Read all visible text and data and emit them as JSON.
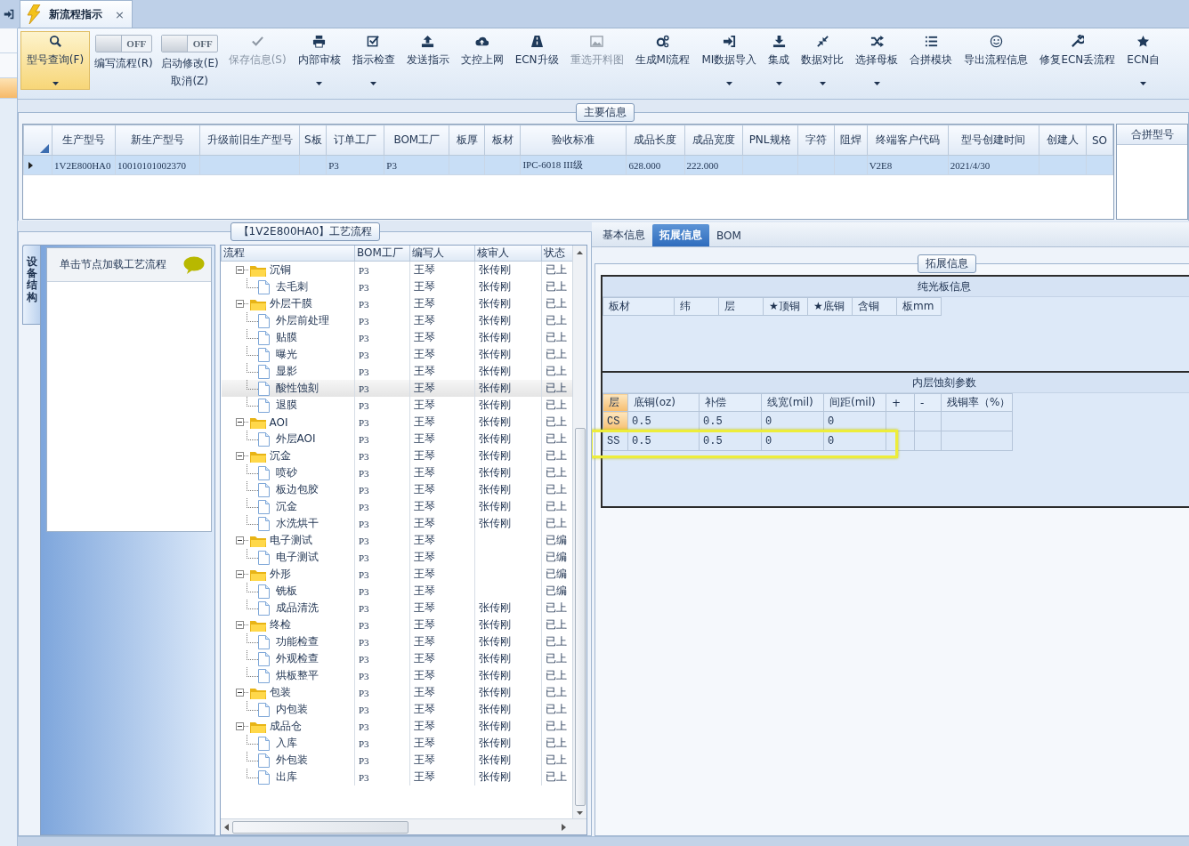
{
  "side_nav": [
    {
      "selected": false
    },
    {
      "selected": false
    },
    {
      "selected": true
    }
  ],
  "document_tab": {
    "title": "新流程指示",
    "close": "×"
  },
  "toolbar": [
    {
      "kind": "button",
      "label": "型号查询(F)",
      "selected": true,
      "disabled": false,
      "dropdown": true
    },
    {
      "kind": "toggle",
      "label": "编写流程(R)",
      "on": false,
      "state_label": "OFF"
    },
    {
      "kind": "toggle",
      "label": "启动修改(E)",
      "sublabel": "取消(Z)",
      "on": false,
      "state_label": "OFF"
    },
    {
      "kind": "button",
      "label": "保存信息(S)",
      "selected": false,
      "disabled": true,
      "dropdown": false
    },
    {
      "kind": "button",
      "label": "内部审核",
      "selected": false,
      "disabled": false,
      "dropdown": true
    },
    {
      "kind": "button",
      "label": "指示检查",
      "selected": false,
      "disabled": false,
      "dropdown": true
    },
    {
      "kind": "button",
      "label": "发送指示",
      "selected": false,
      "disabled": false,
      "dropdown": false
    },
    {
      "kind": "button",
      "label": "文控上网",
      "selected": false,
      "disabled": false,
      "dropdown": false
    },
    {
      "kind": "button",
      "label": "ECN升级",
      "selected": false,
      "disabled": false,
      "dropdown": false
    },
    {
      "kind": "button",
      "label": "重选开料图",
      "selected": false,
      "disabled": true,
      "dropdown": false
    },
    {
      "kind": "button",
      "label": "生成MI流程",
      "selected": false,
      "disabled": false,
      "dropdown": false
    },
    {
      "kind": "button",
      "label": "MI数据导入",
      "selected": false,
      "disabled": false,
      "dropdown": true
    },
    {
      "kind": "button",
      "label": "集成",
      "selected": false,
      "disabled": false,
      "dropdown": true
    },
    {
      "kind": "button",
      "label": "数据对比",
      "selected": false,
      "disabled": false,
      "dropdown": true
    },
    {
      "kind": "button",
      "label": "选择母板",
      "selected": false,
      "disabled": false,
      "dropdown": true
    },
    {
      "kind": "button",
      "label": "合拼模块",
      "selected": false,
      "disabled": false,
      "dropdown": false
    },
    {
      "kind": "button",
      "label": "导出流程信息",
      "selected": false,
      "disabled": false,
      "dropdown": false
    },
    {
      "kind": "button",
      "label": "修复ECN丢流程",
      "selected": false,
      "disabled": false,
      "dropdown": false
    },
    {
      "kind": "button",
      "label": "ECN自",
      "selected": false,
      "disabled": false,
      "dropdown": true
    }
  ],
  "main_info": {
    "title": "主要信息",
    "row_selected": true,
    "side_column": "合拼型号",
    "columns": [
      {
        "header": "生产型号",
        "value": "1V2E800HA0"
      },
      {
        "header": "新生产型号",
        "value": "10010101002370"
      },
      {
        "header": "升级前旧生产型号"
      },
      {
        "header": "S板"
      },
      {
        "header": "订单工厂",
        "value": "P3"
      },
      {
        "header": "BOM工厂",
        "value": "P3"
      },
      {
        "header": "板厚"
      },
      {
        "header": "板材"
      },
      {
        "header": "验收标准",
        "value": "IPC-6018 III级"
      },
      {
        "header": "成品长度",
        "value": "628.000"
      },
      {
        "header": "成品宽度",
        "value": "222.000"
      },
      {
        "header": "PNL规格"
      },
      {
        "header": "字符"
      },
      {
        "header": "阻焊"
      },
      {
        "header": "终端客户代码",
        "value": "V2E8"
      },
      {
        "header": "型号创建时间",
        "value": "2021/4/30"
      },
      {
        "header": "创建人"
      },
      {
        "header": "SO"
      }
    ]
  },
  "process": {
    "title": "【1V2E800HA0】工艺流程",
    "side_tab": {
      "label": "设备结构",
      "selected": true
    },
    "side_header": "单击节点加载工艺流程",
    "columns": [
      "流程",
      "BOM工厂",
      "编写人",
      "核审人",
      "状态"
    ],
    "nodes": [
      {
        "kind": "folder",
        "label": "沉铜",
        "expanded": true,
        "selected": false,
        "bom": "P3",
        "writer": "王琴",
        "reviewer": "张传刚",
        "status": "已上",
        "children": [
          {
            "kind": "file",
            "label": "去毛刺",
            "selected": false,
            "bom": "P3",
            "writer": "王琴",
            "reviewer": "张传刚",
            "status": "已上"
          }
        ]
      },
      {
        "kind": "folder",
        "label": "外层干膜",
        "expanded": true,
        "selected": false,
        "bom": "P3",
        "writer": "王琴",
        "reviewer": "张传刚",
        "status": "已上",
        "children": [
          {
            "kind": "file",
            "label": "外层前处理",
            "selected": false,
            "bom": "P3",
            "writer": "王琴",
            "reviewer": "张传刚",
            "status": "已上"
          },
          {
            "kind": "file",
            "label": "贴膜",
            "selected": false,
            "bom": "P3",
            "writer": "王琴",
            "reviewer": "张传刚",
            "status": "已上"
          },
          {
            "kind": "file",
            "label": "曝光",
            "selected": false,
            "bom": "P3",
            "writer": "王琴",
            "reviewer": "张传刚",
            "status": "已上"
          },
          {
            "kind": "file",
            "label": "显影",
            "selected": false,
            "bom": "P3",
            "writer": "王琴",
            "reviewer": "张传刚",
            "status": "已上"
          },
          {
            "kind": "file",
            "label": "酸性蚀刻",
            "selected": true,
            "bom": "P3",
            "writer": "王琴",
            "reviewer": "张传刚",
            "status": "已上"
          },
          {
            "kind": "file",
            "label": "退膜",
            "selected": false,
            "bom": "P3",
            "writer": "王琴",
            "reviewer": "张传刚",
            "status": "已上"
          }
        ]
      },
      {
        "kind": "folder",
        "label": "AOI",
        "expanded": true,
        "selected": false,
        "bom": "P3",
        "writer": "王琴",
        "reviewer": "张传刚",
        "status": "已上",
        "children": [
          {
            "kind": "file",
            "label": "外层AOI",
            "selected": false,
            "bom": "P3",
            "writer": "王琴",
            "reviewer": "张传刚",
            "status": "已上"
          }
        ]
      },
      {
        "kind": "folder",
        "label": "沉金",
        "expanded": true,
        "selected": false,
        "bom": "P3",
        "writer": "王琴",
        "reviewer": "张传刚",
        "status": "已上",
        "children": [
          {
            "kind": "file",
            "label": "喷砂",
            "selected": false,
            "bom": "P3",
            "writer": "王琴",
            "reviewer": "张传刚",
            "status": "已上"
          },
          {
            "kind": "file",
            "label": "板边包胶",
            "selected": false,
            "bom": "P3",
            "writer": "王琴",
            "reviewer": "张传刚",
            "status": "已上"
          },
          {
            "kind": "file",
            "label": "沉金",
            "selected": false,
            "bom": "P3",
            "writer": "王琴",
            "reviewer": "张传刚",
            "status": "已上"
          },
          {
            "kind": "file",
            "label": "水洗烘干",
            "selected": false,
            "bom": "P3",
            "writer": "王琴",
            "reviewer": "张传刚",
            "status": "已上"
          }
        ]
      },
      {
        "kind": "folder",
        "label": "电子测试",
        "expanded": true,
        "selected": false,
        "bom": "P3",
        "writer": "王琴",
        "status": "已编",
        "children": [
          {
            "kind": "file",
            "label": "电子测试",
            "selected": false,
            "bom": "P3",
            "writer": "王琴",
            "status": "已编"
          }
        ]
      },
      {
        "kind": "folder",
        "label": "外形",
        "expanded": true,
        "selected": false,
        "bom": "P3",
        "writer": "王琴",
        "status": "已编",
        "children": [
          {
            "kind": "file",
            "label": "铣板",
            "selected": false,
            "bom": "P3",
            "writer": "王琴",
            "status": "已编"
          },
          {
            "kind": "file",
            "label": "成品清洗",
            "selected": false,
            "bom": "P3",
            "writer": "王琴",
            "reviewer": "张传刚",
            "status": "已上"
          }
        ]
      },
      {
        "kind": "folder",
        "label": "终检",
        "expanded": true,
        "selected": false,
        "bom": "P3",
        "writer": "王琴",
        "reviewer": "张传刚",
        "status": "已上",
        "children": [
          {
            "kind": "file",
            "label": "功能检查",
            "selected": false,
            "bom": "P3",
            "writer": "王琴",
            "reviewer": "张传刚",
            "status": "已上"
          },
          {
            "kind": "file",
            "label": "外观检查",
            "selected": false,
            "bom": "P3",
            "writer": "王琴",
            "reviewer": "张传刚",
            "status": "已上"
          },
          {
            "kind": "file",
            "label": "烘板整平",
            "selected": false,
            "bom": "P3",
            "writer": "王琴",
            "reviewer": "张传刚",
            "status": "已上"
          }
        ]
      },
      {
        "kind": "folder",
        "label": "包装",
        "expanded": true,
        "selected": false,
        "bom": "P3",
        "writer": "王琴",
        "reviewer": "张传刚",
        "status": "已上",
        "children": [
          {
            "kind": "file",
            "label": "内包装",
            "selected": false,
            "bom": "P3",
            "writer": "王琴",
            "reviewer": "张传刚",
            "status": "已上"
          }
        ]
      },
      {
        "kind": "folder",
        "label": "成品仓",
        "expanded": true,
        "selected": false,
        "bom": "P3",
        "writer": "王琴",
        "reviewer": "张传刚",
        "status": "已上",
        "children": [
          {
            "kind": "file",
            "label": "入库",
            "selected": false,
            "bom": "P3",
            "writer": "王琴",
            "reviewer": "张传刚",
            "status": "已上"
          },
          {
            "kind": "file",
            "label": "外包装",
            "selected": false,
            "bom": "P3",
            "writer": "王琴",
            "reviewer": "张传刚",
            "status": "已上"
          },
          {
            "kind": "file",
            "label": "出库",
            "selected": false,
            "bom": "P3",
            "writer": "王琴",
            "reviewer": "张传刚",
            "status": "已上"
          }
        ]
      }
    ]
  },
  "extension": {
    "tabs": [
      {
        "label": "基本信息",
        "selected": false
      },
      {
        "label": "拓展信息",
        "selected": true
      },
      {
        "label": "BOM",
        "selected": false
      }
    ],
    "group_title": "拓展信息",
    "bare_board": {
      "title": "纯光板信息",
      "columns": [
        "板材",
        "纬",
        "层",
        "★顶铜",
        "★底铜",
        "含铜",
        "板mm"
      ]
    },
    "etch": {
      "title": "内层蚀刻参数",
      "columns": [
        "层",
        "底铜(oz)",
        "补偿",
        "线宽(mil)",
        "间距(mil)",
        "+",
        "-",
        "残铜率（%）"
      ],
      "rows": [
        {
          "selected": true,
          "highlighted": false,
          "cells": [
            "CS",
            "0.5",
            "0.5",
            "0",
            "0"
          ]
        },
        {
          "selected": false,
          "highlighted": true,
          "cells": [
            "SS",
            "0.5",
            "0.5",
            "0",
            "0"
          ]
        }
      ]
    }
  }
}
